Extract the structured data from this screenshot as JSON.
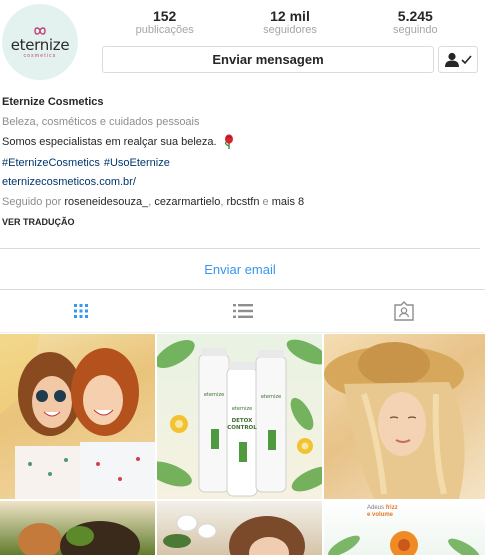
{
  "profile": {
    "logo_word": "eternize",
    "logo_sub": "cosmetics"
  },
  "stats": [
    {
      "value": "152",
      "label": "publicações"
    },
    {
      "value": "12 mil",
      "label": "seguidores"
    },
    {
      "value": "5.245",
      "label": "seguindo"
    }
  ],
  "actions": {
    "message_label": "Enviar mensagem",
    "following_icon": "person-check-icon"
  },
  "bio": {
    "name": "Eternize Cosmetics",
    "category": "Beleza, cosméticos e cuidados pessoais",
    "tagline": "Somos especialistas em realçar sua beleza.",
    "hashtags": [
      "#EternizeCosmetics",
      "#UsoEternize"
    ],
    "website": "eternizecosmeticos.com.br/",
    "followed_prefix": "Seguido por",
    "followed_users": [
      "roseneidesouza_",
      "cezarmartielo",
      "rbcstfn"
    ],
    "followed_sep_comma": ",",
    "followed_and": "e",
    "followed_more": "mais 8",
    "translate": "VER TRADUÇÃO"
  },
  "email_action": "Enviar email",
  "tabs": [
    {
      "name": "grid-icon"
    },
    {
      "name": "list-icon"
    },
    {
      "name": "tagged-icon"
    }
  ],
  "tiles": {
    "product_brand": "eternize",
    "product_line": [
      "DETOX",
      "CONTROL"
    ],
    "caption_adeus": "Adeus",
    "caption_frizz": "frizz",
    "caption_e_volume": "e volume"
  },
  "colors": {
    "accent_blue": "#3897f0",
    "link_blue": "#00376b",
    "muted": "#8e8e8e",
    "border": "#dbdbdb",
    "avatar_bg": "#e4f2ef"
  }
}
